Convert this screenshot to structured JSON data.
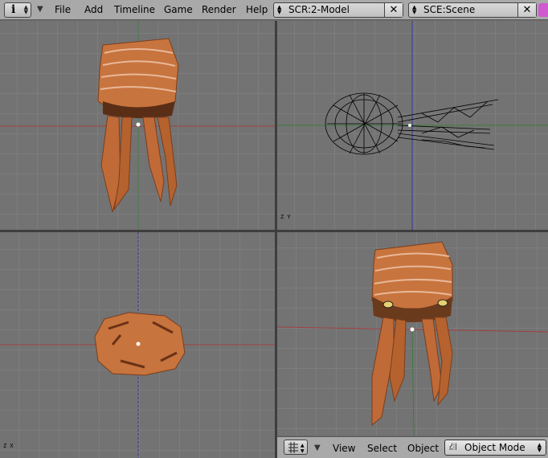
{
  "header": {
    "info_glyph": "i",
    "menus": [
      "File",
      "Add",
      "Timeline",
      "Game",
      "Render",
      "Help"
    ],
    "screen_field": "SCR:2-Model",
    "scene_field": "SCE:Scene",
    "close_glyph": "✕"
  },
  "viewports": {
    "top_right_axis": "Z Y",
    "bottom_left_axis": "Z X"
  },
  "view3d_header": {
    "menus": [
      "View",
      "Select",
      "Object"
    ],
    "mode": "Object Mode"
  },
  "colors": {
    "grid_bg": "#737373",
    "x_axis": "#a04040",
    "y_axis": "#3e7c3e",
    "z_axis": "#3a3aa0",
    "mesh_skin": "#c8743e"
  }
}
